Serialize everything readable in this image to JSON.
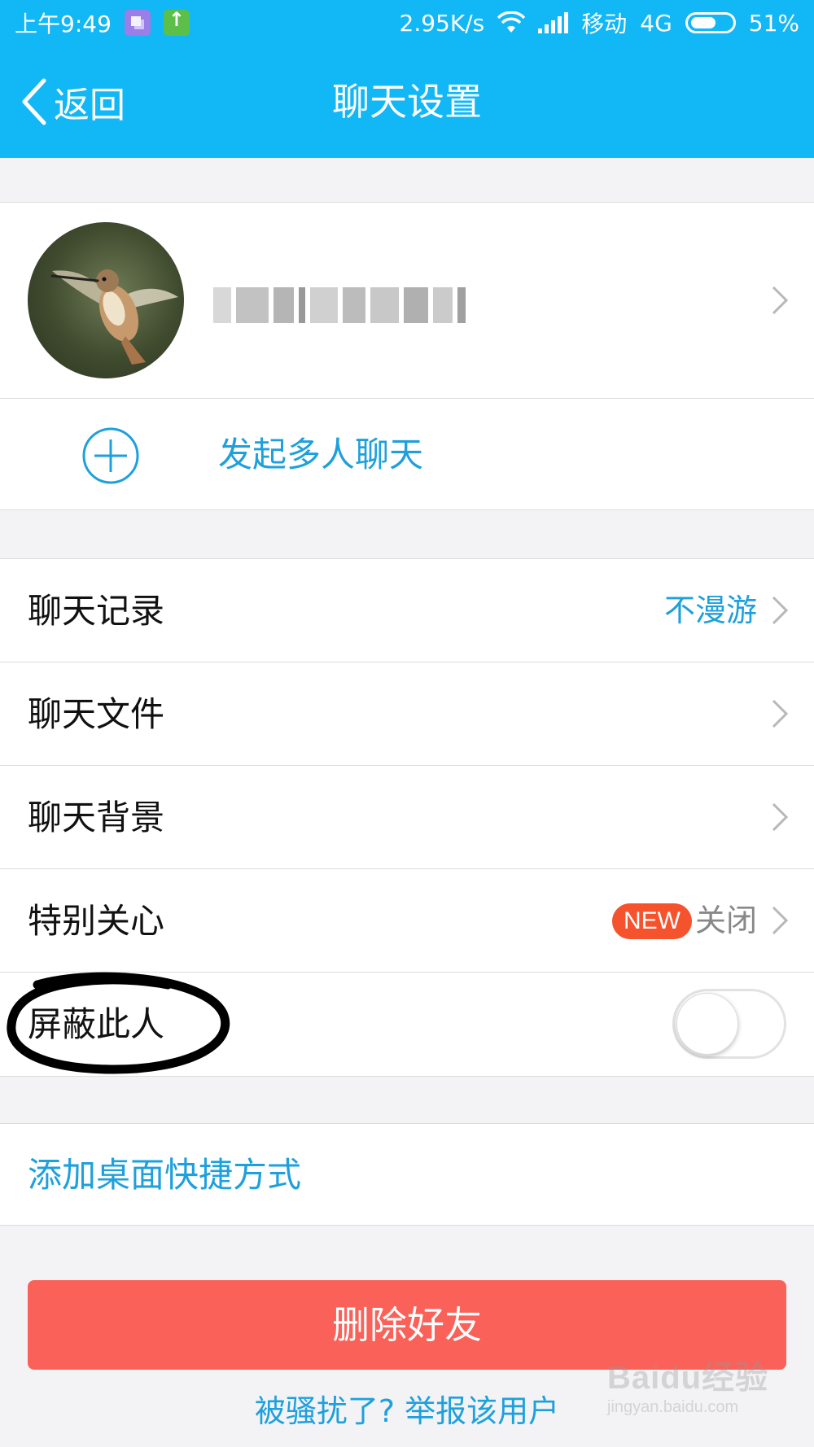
{
  "status_bar": {
    "time": "上午9:49",
    "net_speed": "2.95K/s",
    "carrier": "移动",
    "network_type": "4G",
    "battery": "51%"
  },
  "nav": {
    "back_label": "返回",
    "title": "聊天设置"
  },
  "profile": {
    "nickname": ""
  },
  "start_group_chat": "发起多人聊天",
  "settings": {
    "chat_history": {
      "label": "聊天记录",
      "value": "不漫游"
    },
    "chat_files": {
      "label": "聊天文件"
    },
    "chat_background": {
      "label": "聊天背景"
    },
    "special_care": {
      "label": "特别关心",
      "badge": "NEW",
      "value": "关闭"
    },
    "block_user": {
      "label": "屏蔽此人",
      "enabled": false
    }
  },
  "add_shortcut": "添加桌面快捷方式",
  "delete_friend": "删除好友",
  "report_link": "被骚扰了? 举报该用户",
  "watermark": {
    "brand": "Baidu经验",
    "url": "jingyan.baidu.com"
  },
  "colors": {
    "accent": "#12b7f5",
    "link": "#1ea0dc",
    "danger": "#f96159",
    "badge": "#f5532d"
  }
}
